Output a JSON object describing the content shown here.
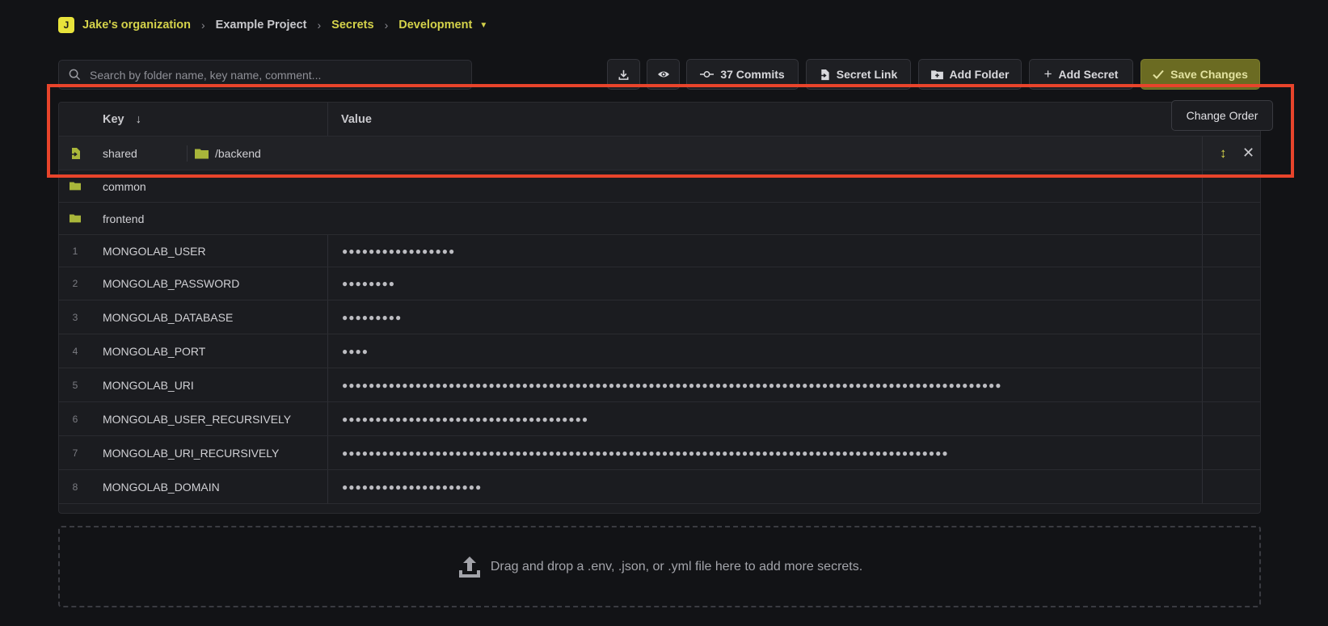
{
  "breadcrumb": {
    "org_initial": "J",
    "organization": "Jake's organization",
    "project": "Example Project",
    "section": "Secrets",
    "environment": "Development"
  },
  "search": {
    "placeholder": "Search by folder name, key name, comment..."
  },
  "toolbar": {
    "commits_label": "37 Commits",
    "secret_link_label": "Secret Link",
    "add_folder_label": "Add Folder",
    "add_secret_label": "Add Secret",
    "save_label": "Save Changes"
  },
  "table": {
    "key_header": "Key",
    "value_header": "Value",
    "import_row": {
      "environment": "shared",
      "path": "/backend"
    },
    "folders": [
      "common",
      "frontend"
    ],
    "secrets": [
      {
        "num": "1",
        "key": "MONGOLAB_USER",
        "value": "●●●●●●●●●●●●●●●●●"
      },
      {
        "num": "2",
        "key": "MONGOLAB_PASSWORD",
        "value": "●●●●●●●●"
      },
      {
        "num": "3",
        "key": "MONGOLAB_DATABASE",
        "value": "●●●●●●●●●"
      },
      {
        "num": "4",
        "key": "MONGOLAB_PORT",
        "value": "●●●●"
      },
      {
        "num": "5",
        "key": "MONGOLAB_URI",
        "value": "●●●●●●●●●●●●●●●●●●●●●●●●●●●●●●●●●●●●●●●●●●●●●●●●●●●●●●●●●●●●●●●●●●●●●●●●●●●●●●●●●●●●●●●●●●●●●●●●●●●"
      },
      {
        "num": "6",
        "key": "MONGOLAB_USER_RECURSIVELY",
        "value": "●●●●●●●●●●●●●●●●●●●●●●●●●●●●●●●●●●●●●"
      },
      {
        "num": "7",
        "key": "MONGOLAB_URI_RECURSIVELY",
        "value": "●●●●●●●●●●●●●●●●●●●●●●●●●●●●●●●●●●●●●●●●●●●●●●●●●●●●●●●●●●●●●●●●●●●●●●●●●●●●●●●●●●●●●●●●●●●"
      },
      {
        "num": "8",
        "key": "MONGOLAB_DOMAIN",
        "value": "●●●●●●●●●●●●●●●●●●●●●"
      }
    ]
  },
  "tooltip": {
    "text": "Change Order"
  },
  "dropzone": {
    "text": "Drag and drop a .env, .json, or .yml file here to add more secrets."
  },
  "colors": {
    "accent": "#d4d24a",
    "highlight": "#e8442b",
    "background": "#121316"
  }
}
